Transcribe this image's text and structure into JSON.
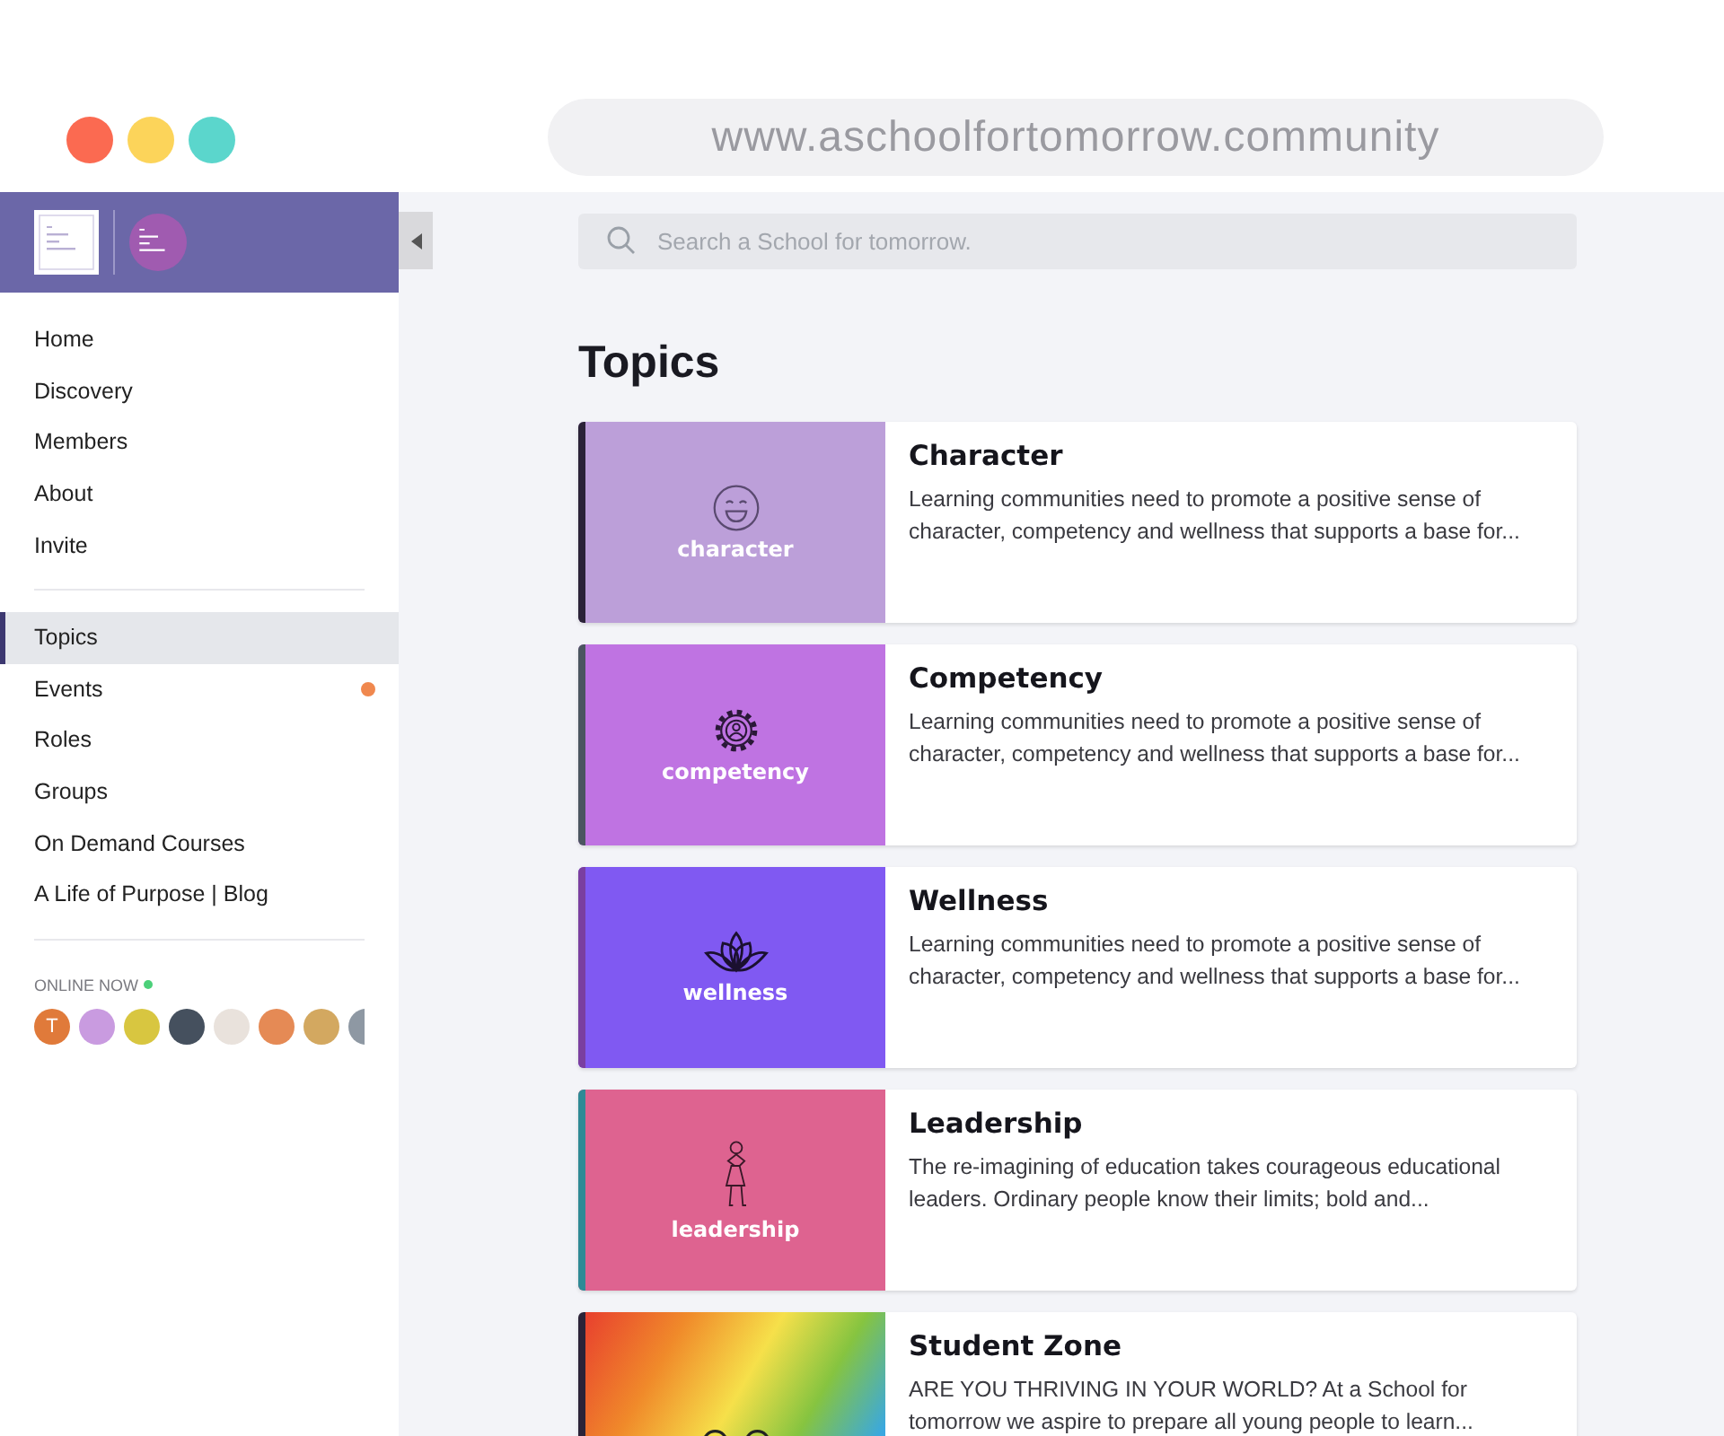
{
  "browser": {
    "url": "www.aschoolfortomorrow.community"
  },
  "sidebar": {
    "nav": [
      {
        "label": "Home",
        "selected": false
      },
      {
        "label": "Discovery",
        "selected": false
      },
      {
        "label": "Members",
        "selected": false
      },
      {
        "label": "About",
        "selected": false
      },
      {
        "label": "Invite",
        "selected": false
      }
    ],
    "sections": [
      {
        "label": "Topics",
        "selected": true,
        "badge": false
      },
      {
        "label": "Events",
        "selected": false,
        "badge": true
      },
      {
        "label": "Roles",
        "selected": false,
        "badge": false
      },
      {
        "label": "Groups",
        "selected": false,
        "badge": false
      },
      {
        "label": "On Demand Courses",
        "selected": false,
        "badge": false
      },
      {
        "label": "A Life of Purpose | Blog",
        "selected": false,
        "badge": false
      }
    ],
    "online_now": {
      "label": "ONLINE NOW",
      "avatars": [
        {
          "initial": "T",
          "color": "#e07a3a"
        },
        {
          "color": "#c99be0"
        },
        {
          "color": "#d8c640"
        },
        {
          "color": "#45505e"
        },
        {
          "color": "#e9e2dc"
        },
        {
          "color": "#e58a55"
        },
        {
          "color": "#d3a860"
        },
        {
          "color": "#8e98a3"
        }
      ]
    }
  },
  "search": {
    "placeholder": "Search a School for tomorrow."
  },
  "page_title": "Topics",
  "topics": [
    {
      "title": "Character",
      "tag": "character",
      "description": "Learning communities need to promote a positive sense of character, competency and wellness that supports a base for..."
    },
    {
      "title": "Competency",
      "tag": "competency",
      "description": "Learning communities need to promote a positive sense of character, competency and wellness that supports a base for..."
    },
    {
      "title": "Wellness",
      "tag": "wellness",
      "description": "Learning communities need to promote a positive sense of character, competency and wellness that supports a base for..."
    },
    {
      "title": "Leadership",
      "tag": "leadership",
      "description": "The re-imagining of education takes courageous educational leaders. Ordinary people know their limits; bold and..."
    },
    {
      "title": "Student Zone",
      "description": "ARE YOU THRIVING IN YOUR WORLD? At a School for tomorrow we aspire to prepare all young people to learn..."
    }
  ]
}
